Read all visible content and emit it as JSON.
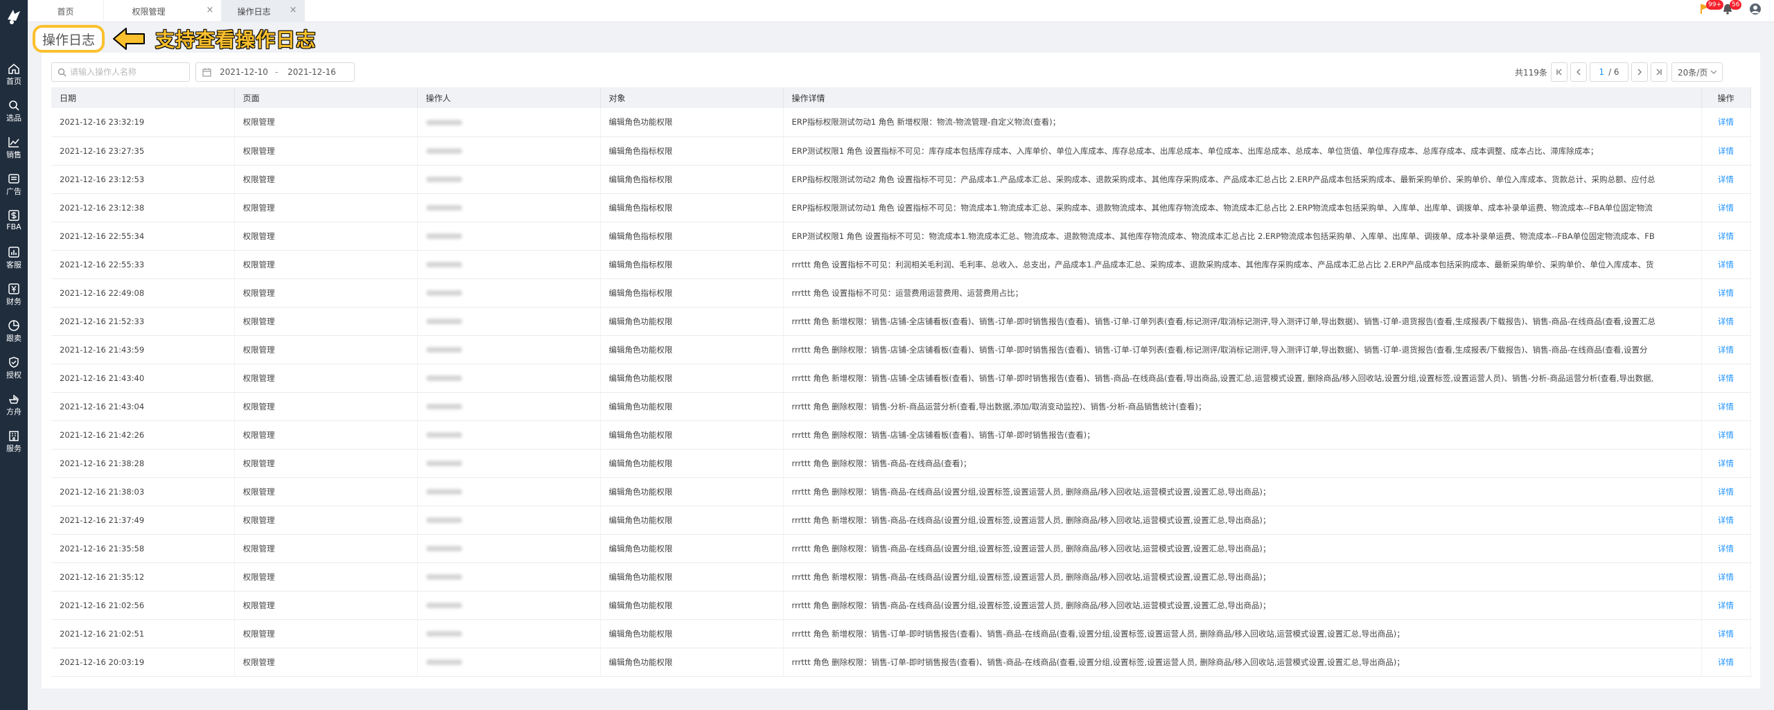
{
  "nav": [
    {
      "label": "首页",
      "icon": "home-icon"
    },
    {
      "label": "选品",
      "icon": "search-icon"
    },
    {
      "label": "销售",
      "icon": "trend-chart-icon"
    },
    {
      "label": "广告",
      "icon": "ad-icon"
    },
    {
      "label": "FBA",
      "icon": "dollar-box-icon"
    },
    {
      "label": "客服",
      "icon": "bar-chart-icon"
    },
    {
      "label": "财务",
      "icon": "finance-icon"
    },
    {
      "label": "跟卖",
      "icon": "pie-chart-icon"
    },
    {
      "label": "授权",
      "icon": "shield-check-icon"
    },
    {
      "label": "方舟",
      "icon": "ark-icon"
    },
    {
      "label": "服务",
      "icon": "building-icon"
    }
  ],
  "tabs": [
    {
      "label": "首页"
    },
    {
      "label": "权限管理"
    },
    {
      "label": "操作日志"
    }
  ],
  "header": {
    "flag_badge": "99+",
    "bell_badge": "56"
  },
  "page": {
    "title": "操作日志",
    "annotation": "支持查看操作日志"
  },
  "filters": {
    "search_placeholder": "请输入操作人名称",
    "date_start": "2021-12-10",
    "date_sep": "-",
    "date_end": "2021-12-16"
  },
  "pagination": {
    "total": "共119条",
    "current": "1",
    "pages": "/ 6",
    "page_size": "20条/页"
  },
  "table": {
    "columns": [
      "日期",
      "页面",
      "操作人",
      "对象",
      "操作详情",
      "操作"
    ],
    "detail_link": "详情",
    "rows": [
      {
        "date": "2021-12-16 23:32:19",
        "page": "权限管理",
        "object": "编辑角色功能权限",
        "detail": "ERP指标权限测试勿动1 角色 新增权限：物流-物流管理-自定义物流(查看)；"
      },
      {
        "date": "2021-12-16 23:27:35",
        "page": "权限管理",
        "object": "编辑角色指标权限",
        "detail": "ERP测试权限1 角色 设置指标不可见：库存成本包括库存成本、入库单价、单位入库成本、库存总成本、出库总成本、单位成本、出库总成本、总成本、单位货值、单位库存成本、总库存成本、成本调整、成本占比、滞库除成本；"
      },
      {
        "date": "2021-12-16 23:12:53",
        "page": "权限管理",
        "object": "编辑角色指标权限",
        "detail": "ERP指标权限测试勿动2 角色 设置指标不可见：产品成本1.产品成本汇总、采购成本、退款采购成本、其他库存采购成本、产品成本汇总占比 2.ERP产品成本包括采购成本、最新采购单价、采购单价、单位入库成本、货款总计、采购总额、应付总"
      },
      {
        "date": "2021-12-16 23:12:38",
        "page": "权限管理",
        "object": "编辑角色指标权限",
        "detail": "ERP指标权限测试勿动1 角色 设置指标不可见：物流成本1.物流成本汇总、采购成本、退款物流成本、其他库存物流成本、物流成本汇总占比 2.ERP物流成本包括采购单、入库单、出库单、调拨单、成本补录单运费、物流成本--FBA单位固定物流"
      },
      {
        "date": "2021-12-16 22:55:34",
        "page": "权限管理",
        "object": "编辑角色指标权限",
        "detail": "ERP测试权限1 角色 设置指标不可见：物流成本1.物流成本汇总、物流成本、退款物流成本、其他库存物流成本、物流成本汇总占比 2.ERP物流成本包括采购单、入库单、出库单、调拨单、成本补录单运费、物流成本--FBA单位固定物流成本、FB"
      },
      {
        "date": "2021-12-16 22:55:33",
        "page": "权限管理",
        "object": "编辑角色指标权限",
        "detail": "rrrttt 角色 设置指标不可见：利润相关毛利润、毛利率、总收入、总支出，产品成本1.产品成本汇总、采购成本、退款采购成本、其他库存采购成本、产品成本汇总占比 2.ERP产品成本包括采购成本、最新采购单价、采购单价、单位入库成本、货"
      },
      {
        "date": "2021-12-16 22:49:08",
        "page": "权限管理",
        "object": "编辑角色指标权限",
        "detail": "rrrttt 角色 设置指标不可见：运营费用运营费用、运营费用占比；"
      },
      {
        "date": "2021-12-16 21:52:33",
        "page": "权限管理",
        "object": "编辑角色功能权限",
        "detail": "rrrttt 角色 新增权限：销售-店铺-全店铺看板(查看)、销售-订单-即时销售报告(查看)、销售-订单-订单列表(查看,标记测评/取消标记测评,导入测评订单,导出数据)、销售-订单-退货报告(查看,生成报表/下载报告)、销售-商品-在线商品(查看,设置汇总"
      },
      {
        "date": "2021-12-16 21:43:59",
        "page": "权限管理",
        "object": "编辑角色功能权限",
        "detail": "rrrttt 角色 删除权限：销售-店铺-全店铺看板(查看)、销售-订单-即时销售报告(查看)、销售-订单-订单列表(查看,标记测评/取消标记测评,导入测评订单,导出数据)、销售-订单-退货报告(查看,生成报表/下载报告)、销售-商品-在线商品(查看,设置分"
      },
      {
        "date": "2021-12-16 21:43:40",
        "page": "权限管理",
        "object": "编辑角色功能权限",
        "detail": "rrrttt 角色 新增权限：销售-店铺-全店铺看板(查看)、销售-订单-即时销售报告(查看)、销售-商品-在线商品(查看,导出商品,设置汇总,运营模式设置, 删除商品/移入回收站,设置分组,设置标签,设置运营人员)、销售-分析-商品运营分析(查看,导出数据,"
      },
      {
        "date": "2021-12-16 21:43:04",
        "page": "权限管理",
        "object": "编辑角色功能权限",
        "detail": "rrrttt 角色 删除权限：销售-分析-商品运营分析(查看,导出数据,添加/取消变动监控)、销售-分析-商品销售统计(查看)；"
      },
      {
        "date": "2021-12-16 21:42:26",
        "page": "权限管理",
        "object": "编辑角色功能权限",
        "detail": "rrrttt 角色 删除权限：销售-店铺-全店铺看板(查看)、销售-订单-即时销售报告(查看)；"
      },
      {
        "date": "2021-12-16 21:38:28",
        "page": "权限管理",
        "object": "编辑角色功能权限",
        "detail": "rrrttt 角色 删除权限：销售-商品-在线商品(查看)；"
      },
      {
        "date": "2021-12-16 21:38:03",
        "page": "权限管理",
        "object": "编辑角色功能权限",
        "detail": "rrrttt 角色 删除权限：销售-商品-在线商品(设置分组,设置标签,设置运营人员, 删除商品/移入回收站,运营模式设置,设置汇总,导出商品)；"
      },
      {
        "date": "2021-12-16 21:37:49",
        "page": "权限管理",
        "object": "编辑角色功能权限",
        "detail": "rrrttt 角色 新增权限：销售-商品-在线商品(设置分组,设置标签,设置运营人员, 删除商品/移入回收站,运营模式设置,设置汇总,导出商品)；"
      },
      {
        "date": "2021-12-16 21:35:58",
        "page": "权限管理",
        "object": "编辑角色功能权限",
        "detail": "rrrttt 角色 删除权限：销售-商品-在线商品(设置分组,设置标签,设置运营人员, 删除商品/移入回收站,运营模式设置,设置汇总,导出商品)；"
      },
      {
        "date": "2021-12-16 21:35:12",
        "page": "权限管理",
        "object": "编辑角色功能权限",
        "detail": "rrrttt 角色 新增权限：销售-商品-在线商品(设置分组,设置标签,设置运营人员, 删除商品/移入回收站,运营模式设置,设置汇总,导出商品)；"
      },
      {
        "date": "2021-12-16 21:02:56",
        "page": "权限管理",
        "object": "编辑角色功能权限",
        "detail": "rrrttt 角色 删除权限：销售-商品-在线商品(设置分组,设置标签,设置运营人员, 删除商品/移入回收站,运营模式设置,设置汇总,导出商品)；"
      },
      {
        "date": "2021-12-16 21:02:51",
        "page": "权限管理",
        "object": "编辑角色功能权限",
        "detail": "rrrttt 角色 新增权限：销售-订单-即时销售报告(查看)、销售-商品-在线商品(查看,设置分组,设置标签,设置运营人员, 删除商品/移入回收站,运营模式设置,设置汇总,导出商品)；"
      },
      {
        "date": "2021-12-16 20:03:19",
        "page": "权限管理",
        "object": "编辑角色功能权限",
        "detail": "rrrttt 角色 删除权限：销售-订单-即时销售报告(查看)、销售-商品-在线商品(查看,设置分组,设置标签,设置运营人员, 删除商品/移入回收站,运营模式设置,设置汇总,导出商品)；"
      }
    ]
  }
}
